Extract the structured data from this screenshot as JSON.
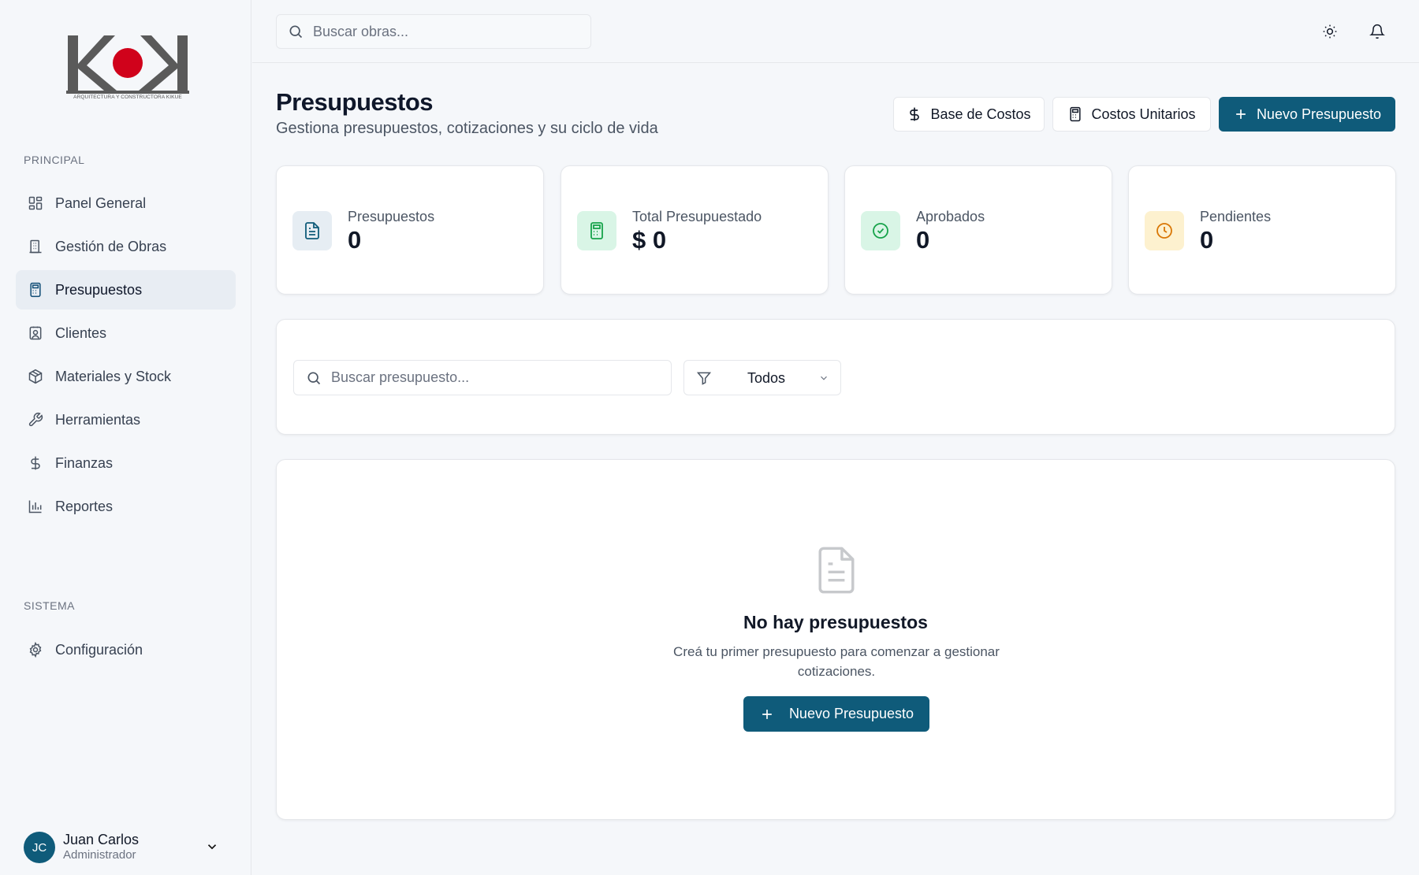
{
  "brand": {
    "logo_text": "KOK",
    "tagline": "ARQUITECTURA Y CONSTRUCTORA KIKUE",
    "accent": "#0f5b7a",
    "logo_dot": "#d0021b"
  },
  "sidebar": {
    "section_principal": "PRINCIPAL",
    "items": [
      {
        "label": "Panel General",
        "icon": "layout-grid-icon",
        "active": false
      },
      {
        "label": "Gestión de Obras",
        "icon": "building-icon",
        "active": false
      },
      {
        "label": "Presupuestos",
        "icon": "calculator-icon",
        "active": true
      },
      {
        "label": "Clientes",
        "icon": "contact-icon",
        "active": false
      },
      {
        "label": "Materiales y Stock",
        "icon": "package-icon",
        "active": false
      },
      {
        "label": "Herramientas",
        "icon": "wrench-icon",
        "active": false
      },
      {
        "label": "Finanzas",
        "icon": "dollar-icon",
        "active": false
      },
      {
        "label": "Reportes",
        "icon": "bar-chart-icon",
        "active": false
      }
    ],
    "section_sistema": "SISTEMA",
    "settings_label": "Configuración",
    "user": {
      "initials": "JC",
      "name": "Juan Carlos",
      "role": "Administrador"
    }
  },
  "topbar": {
    "search_placeholder": "Buscar obras..."
  },
  "header": {
    "title": "Presupuestos",
    "subtitle": "Gestiona presupuestos, cotizaciones y su ciclo de vida",
    "btn_base_costos": "Base de Costos",
    "btn_costos_unitarios": "Costos Unitarios",
    "btn_nuevo": "Nuevo Presupuesto"
  },
  "stats": [
    {
      "label": "Presupuestos",
      "value": "0",
      "icon": "file-text-icon",
      "bg": "#e6edf3",
      "fg": "#0f5b7a"
    },
    {
      "label": "Total Presupuestado",
      "value": "$ 0",
      "icon": "calculator-icon",
      "bg": "#d9f5e6",
      "fg": "#16a34a"
    },
    {
      "label": "Aprobados",
      "value": "0",
      "icon": "check-circle-icon",
      "bg": "#d9f5e6",
      "fg": "#16a34a"
    },
    {
      "label": "Pendientes",
      "value": "0",
      "icon": "clock-icon",
      "bg": "#fdf1cf",
      "fg": "#d97706"
    }
  ],
  "filters": {
    "search_placeholder": "Buscar presupuesto...",
    "status_value": "Todos"
  },
  "empty": {
    "title": "No hay presupuestos",
    "text": "Creá tu primer presupuesto para comenzar a gestionar cotizaciones.",
    "button": "Nuevo Presupuesto"
  }
}
